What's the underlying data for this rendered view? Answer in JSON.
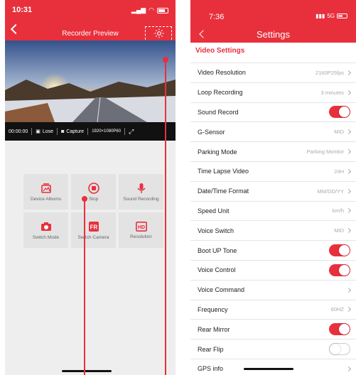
{
  "left": {
    "status_time": "10:31",
    "header_title": "Recorder Preview",
    "controls": {
      "timer": "00:00:00",
      "lose": "Lose",
      "capture": "Capture",
      "resolution": "1920×1080P60"
    },
    "tiles": [
      {
        "label": "Device Albums",
        "icon": "album-icon"
      },
      {
        "label": "Stop",
        "icon": "stop-icon"
      },
      {
        "label": "Sound Recording",
        "icon": "microphone-icon"
      },
      {
        "label": "Switch Mode",
        "icon": "camera-icon"
      },
      {
        "label": "Switch Camera",
        "icon": "switch-camera-icon"
      },
      {
        "label": "Resolution",
        "icon": "hd-icon"
      }
    ]
  },
  "right": {
    "status_time": "7:36",
    "network": "5G",
    "header_title": "Settings",
    "section_title": "Video Settings",
    "rows": [
      {
        "name": "Video Resolution",
        "value": "2160P25fps",
        "control": "chevron"
      },
      {
        "name": "Loop Recording",
        "value": "3 minutes",
        "control": "chevron"
      },
      {
        "name": "Sound Record",
        "value": "",
        "control": "toggle-on"
      },
      {
        "name": "G-Sensor",
        "value": "MID",
        "control": "chevron"
      },
      {
        "name": "Parking Mode",
        "value": "Parking Monitor",
        "control": "chevron"
      },
      {
        "name": "Time Lapse Video",
        "value": "24H",
        "control": "chevron"
      },
      {
        "name": "Date/Time Format",
        "value": "MM/DD/YY",
        "control": "chevron"
      },
      {
        "name": "Speed Unit",
        "value": "km/h",
        "control": "chevron"
      },
      {
        "name": "Voice Switch",
        "value": "MID",
        "control": "chevron"
      },
      {
        "name": "Boot UP Tone",
        "value": "",
        "control": "toggle-on"
      },
      {
        "name": "Voice Control",
        "value": "",
        "control": "toggle-on"
      },
      {
        "name": "Voice Command",
        "value": "",
        "control": "chevron"
      },
      {
        "name": "Frequency",
        "value": "60HZ",
        "control": "chevron"
      },
      {
        "name": "Rear Mirror",
        "value": "",
        "control": "toggle-on"
      },
      {
        "name": "Rear Flip",
        "value": "",
        "control": "toggle-off"
      },
      {
        "name": "GPS info",
        "value": "",
        "control": "chevron"
      }
    ]
  },
  "colors": {
    "accent": "#e8303c",
    "background": "#eeeeee"
  }
}
